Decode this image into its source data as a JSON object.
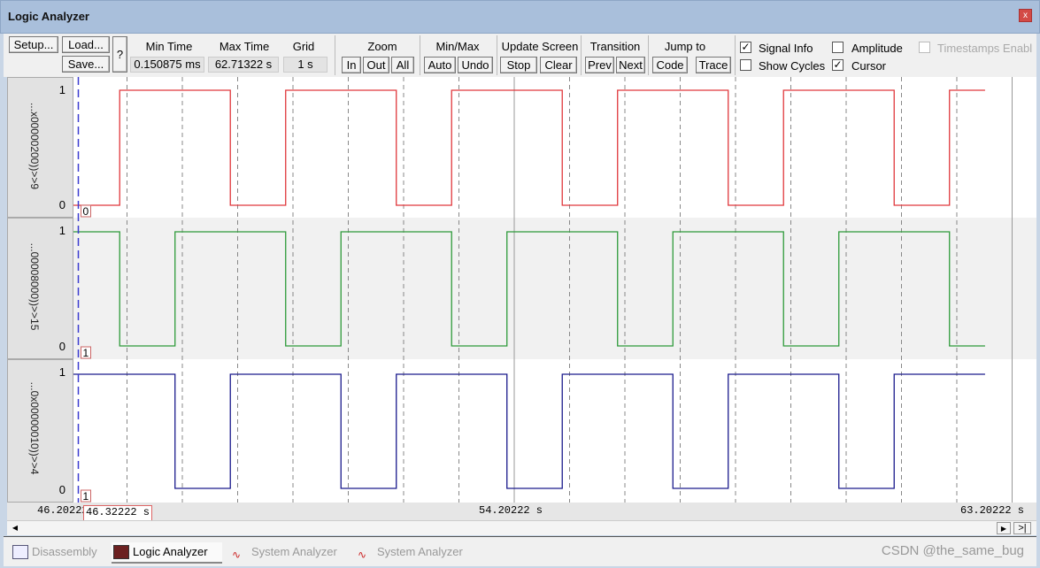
{
  "window": {
    "title": "Logic Analyzer",
    "close": "x"
  },
  "toolbar": {
    "setup": "Setup...",
    "load": "Load...",
    "save": "Save...",
    "help": "?",
    "min_time_label": "Min Time",
    "min_time": "0.150875 ms",
    "max_time_label": "Max Time",
    "max_time": "62.71322 s",
    "grid_label": "Grid",
    "grid": "1 s",
    "zoom_label": "Zoom",
    "zoom_in": "In",
    "zoom_out": "Out",
    "zoom_all": "All",
    "minmax_label": "Min/Max",
    "auto": "Auto",
    "undo": "Undo",
    "update_label": "Update Screen",
    "stop": "Stop",
    "clear": "Clear",
    "transition_label": "Transition",
    "prev": "Prev",
    "next": "Next",
    "jump_label": "Jump to",
    "code": "Code",
    "trace": "Trace",
    "signal_info": {
      "label": "Signal Info",
      "checked": true
    },
    "amplitude": {
      "label": "Amplitude",
      "checked": false
    },
    "timestamps": {
      "label": "Timestamps Enabl",
      "checked": false,
      "disabled": true
    },
    "show_cycles": {
      "label": "Show Cycles",
      "checked": false
    },
    "cursor": {
      "label": "Cursor",
      "checked": true
    }
  },
  "signals": [
    {
      "name": "...x00000200))>>9",
      "high": "1",
      "low": "0",
      "color": "#e0383c",
      "marker": "0",
      "changes": [
        [
          46.32222,
          0
        ],
        [
          47.07,
          1
        ],
        [
          49.07,
          0
        ],
        [
          50.07,
          1
        ],
        [
          52.07,
          0
        ],
        [
          53.07,
          1
        ],
        [
          55.07,
          0
        ],
        [
          56.07,
          1
        ],
        [
          58.07,
          0
        ],
        [
          59.07,
          1
        ],
        [
          61.07,
          0
        ],
        [
          62.07,
          1
        ]
      ]
    },
    {
      "name": "...00008000))>>15",
      "high": "1",
      "low": "0",
      "color": "#2e9a3a",
      "marker": "1",
      "changes": [
        [
          46.32222,
          1
        ],
        [
          47.07,
          0
        ],
        [
          48.07,
          1
        ],
        [
          50.07,
          0
        ],
        [
          51.07,
          1
        ],
        [
          53.07,
          0
        ],
        [
          54.07,
          1
        ],
        [
          56.07,
          0
        ],
        [
          57.07,
          1
        ],
        [
          59.07,
          0
        ],
        [
          60.07,
          1
        ],
        [
          62.07,
          0
        ]
      ]
    },
    {
      "name": "...0x00000010))>>4",
      "high": "1",
      "low": "0",
      "color": "#1a1a8c",
      "marker": "1",
      "changes": [
        [
          46.32222,
          1
        ],
        [
          48.07,
          0
        ],
        [
          49.07,
          1
        ],
        [
          51.07,
          0
        ],
        [
          52.07,
          1
        ],
        [
          54.07,
          0
        ],
        [
          55.07,
          1
        ],
        [
          57.07,
          0
        ],
        [
          58.07,
          1
        ],
        [
          60.07,
          0
        ],
        [
          61.07,
          1
        ]
      ]
    }
  ],
  "time_axis": {
    "start": "46.20222",
    "mid": "54.20222  s",
    "end": "63.20222  s",
    "start_value": 46.20222,
    "mid_value": 54.20222,
    "end_value": 63.20222,
    "end_time": 62.71322,
    "grid_s": 1
  },
  "cursor": {
    "label": "46.32222  s",
    "time": 46.32222,
    "color": "#3a3ad0"
  },
  "tabs": [
    {
      "label": "Disassembly",
      "active": false
    },
    {
      "label": "Logic Analyzer",
      "active": true
    },
    {
      "label": "System Analyzer",
      "active": false
    },
    {
      "label": "System Analyzer",
      "active": false
    }
  ],
  "watermark": "CSDN @the_same_bug"
}
